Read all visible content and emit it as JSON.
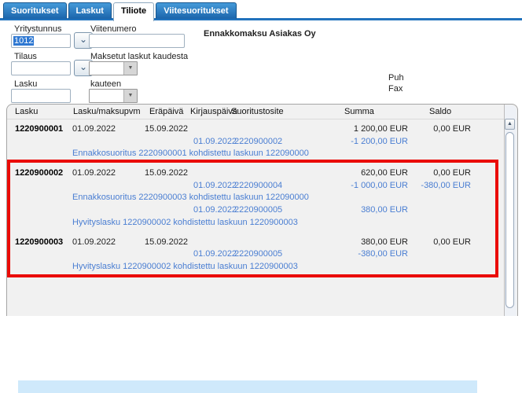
{
  "tabs": [
    {
      "label": "Suoritukset",
      "active": false
    },
    {
      "label": "Laskut",
      "active": false
    },
    {
      "label": "Tiliote",
      "active": true
    },
    {
      "label": "Viitesuoritukset",
      "active": false
    }
  ],
  "form": {
    "yritystunnus": {
      "label": "Yritystunnus",
      "value": "1012"
    },
    "viitenumero": {
      "label": "Viitenumero",
      "value": ""
    },
    "tilaus": {
      "label": "Tilaus",
      "value": ""
    },
    "maksetut": {
      "label": "Maksetut laskut kaudesta",
      "value": ""
    },
    "lasku": {
      "label": "Lasku",
      "value": ""
    },
    "kauteen": {
      "label": "kauteen",
      "value": ""
    }
  },
  "customer": {
    "name": "Ennakkomaksu Asiakas Oy",
    "puh_label": "Puh",
    "fax_label": "Fax"
  },
  "icons": {
    "dropdown_chevron": "⌄",
    "combo_arrow": "▼",
    "scroll_up": "▲"
  },
  "colors": {
    "tab_blue": "#2273bd",
    "link_blue": "#4a7ed2",
    "highlight_red": "#ea0b06",
    "selection_blue": "#cfe9fb",
    "selected_text_bg": "#2e78d2"
  },
  "table": {
    "columns": [
      "Lasku",
      "Lasku/maksupvm",
      "Eräpäivä",
      "Kirjauspäivä",
      "Suoritustosite",
      "Summa",
      "Saldo"
    ],
    "lines": [
      {
        "type": "invoice",
        "lasku": "1220900001",
        "pvm": "01.09.2022",
        "era": "15.09.2022",
        "summa": "1 200,00 EUR",
        "saldo": "0,00 EUR"
      },
      {
        "type": "payment",
        "kirj": "01.09.2022",
        "tosite": "2220900002",
        "summa": "-1 200,00 EUR"
      },
      {
        "type": "note",
        "note": "Ennakkosuoritus 2220900001 kohdistettu laskuun 122090000"
      },
      {
        "type": "invoice",
        "gap": true,
        "lasku": "1220900002",
        "pvm": "01.09.2022",
        "era": "15.09.2022",
        "summa": "620,00 EUR",
        "saldo": "0,00 EUR"
      },
      {
        "type": "payment",
        "kirj": "01.09.2022",
        "tosite": "2220900004",
        "summa": "-1 000,00 EUR",
        "saldo": "-380,00 EUR"
      },
      {
        "type": "note",
        "note": "Ennakkosuoritus 2220900003 kohdistettu laskuun 122090000"
      },
      {
        "type": "payment",
        "kirj": "01.09.2022",
        "tosite": "2220900005",
        "summa": "380,00 EUR"
      },
      {
        "type": "note",
        "note": "Hyvityslasku 1220900002 kohdistettu laskuun 1220900003"
      },
      {
        "type": "invoice",
        "gap": true,
        "lasku": "1220900003",
        "pvm": "01.09.2022",
        "era": "15.09.2022",
        "summa": "380,00 EUR",
        "saldo": "0,00 EUR"
      },
      {
        "type": "payment",
        "kirj": "01.09.2022",
        "tosite": "2220900005",
        "summa": "-380,00 EUR"
      },
      {
        "type": "note",
        "note": "Hyvityslasku 1220900002 kohdistettu laskuun 1220900003"
      }
    ]
  }
}
